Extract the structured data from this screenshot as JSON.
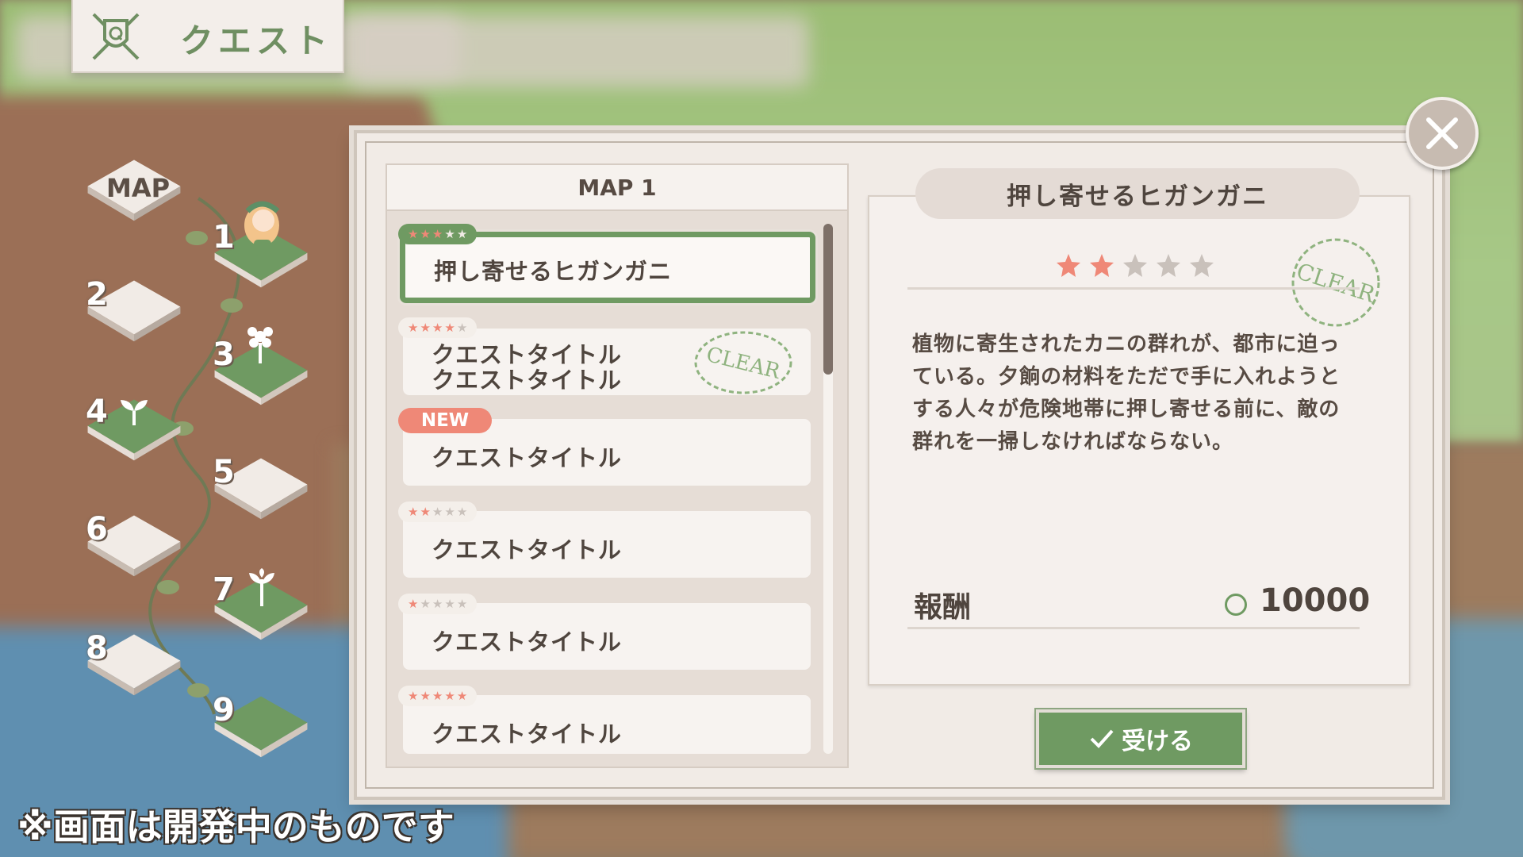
{
  "header": {
    "title": "クエスト",
    "emblem_icon": "crossed-swords-shield-icon"
  },
  "map": {
    "label": "MAP",
    "tiles": [
      "1",
      "2",
      "3",
      "4",
      "5",
      "6",
      "7",
      "8",
      "9"
    ]
  },
  "list": {
    "header": "MAP 1",
    "items": [
      {
        "title": "押し寄せるヒガンガニ",
        "stars": 5,
        "filled": 3,
        "selected": true
      },
      {
        "title_line1": "クエストタイトル",
        "title_line2": "クエストタイトル",
        "stars": 5,
        "filled": 4,
        "clear": true
      },
      {
        "title": "クエストタイトル",
        "badge": "NEW"
      },
      {
        "title": "クエストタイトル",
        "stars": 5,
        "filled": 2
      },
      {
        "title": "クエストタイトル",
        "stars": 5,
        "filled": 1
      },
      {
        "title": "クエストタイトル",
        "stars": 5,
        "filled": 5
      }
    ],
    "clear_stamp": "CLEAR"
  },
  "detail": {
    "title": "押し寄せるヒガンガニ",
    "stars_total": 5,
    "stars_filled": 2,
    "clear_stamp": "CLEAR",
    "description": "植物に寄生されたカニの群れが、都市に迫っている。夕餉の材料をただで手に入れようとする人々が危険地帯に押し寄せる前に、敵の群れを一掃しなければならない。",
    "reward_label": "報酬",
    "reward_value": "10000",
    "accept_label": "受ける"
  },
  "footer_note": "※画面は開発中のものです",
  "colors": {
    "accent": "#6f9a62",
    "panel": "#f1ebe6",
    "star_on": "#ef8877",
    "star_off": "#c9c1bb"
  }
}
